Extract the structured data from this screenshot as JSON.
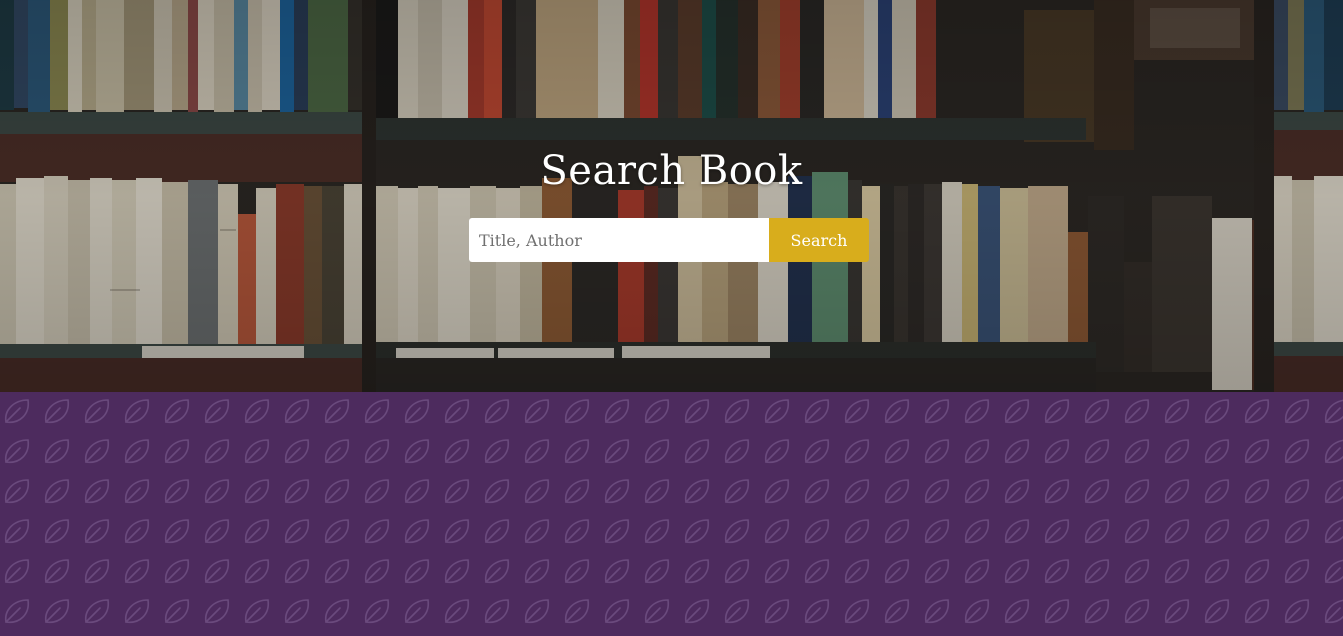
{
  "hero": {
    "title": "Search Book"
  },
  "search": {
    "placeholder": "Title, Author",
    "value": "",
    "button_label": "Search"
  },
  "colors": {
    "accent": "#d8ad1c",
    "background": "#4d2b5e",
    "pattern": "#6a4a7d"
  },
  "icons": {
    "pattern_motif": "leaf-icon"
  }
}
